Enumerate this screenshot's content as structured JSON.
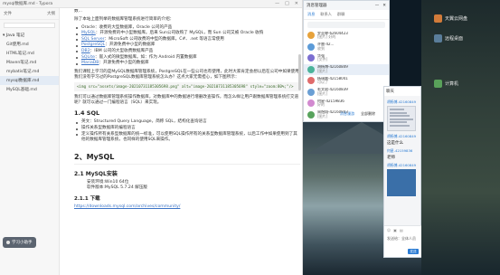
{
  "typora": {
    "title": "mysql数据库.md - Typora",
    "controls": [
      "—",
      "□",
      "✕"
    ]
  },
  "sidebar": {
    "tab_files": "文件",
    "tab_outline": "大纲",
    "folder": "Java 笔记",
    "items": [
      "Git使用.md",
      "HTML笔记.md",
      "Maven笔记.md",
      "mybatis笔记.md",
      "mysql数据库.md",
      "MySQL基础.md"
    ],
    "badge": "学习小助手"
  },
  "editor": {
    "intro_tail": "数...",
    "intro": "除了本站上面列举的数据库管理系统进行简单的介绍：",
    "bullets": [
      [
        "",
        "Oracle：收费的大型数据库，Oracle 公司的产品"
      ],
      [
        "MySQL",
        "：开源免费的中小型数据库。后来 Sun公司收购了 MySQL，而 Sun 公司又被 Oracle 收购"
      ],
      [
        "SQL Server",
        "：MicroSoft 公司收费的中型的数据库。C#、.net 等语言常使用"
      ],
      [
        "PostgreSQL",
        "：开源免费中小型的数据库"
      ],
      [
        "DB2",
        "：IBM 公司的大型收费数据库产品"
      ],
      [
        "SQLite",
        "：嵌入式的微型数据库。如：作为 Android 内置数据库"
      ],
      [
        "MariaDB",
        "：开源免费中小型的数据库"
      ]
    ],
    "para1": "我们课程上学习的是MySQL数据库管理系统，PostgreSQL在一些公司也有使用，此时大家肯定会想以后在公司中如果使用我们没有学习过的PostgreSQL数据库管理系统怎么办？这点大家无需担心，如下图所示：",
    "code": "<img src=\"assets/image-20210731185305698.png\" alt=\"image-20210731185305698\" style=\"zoom:80%;\"/>",
    "para2": "我们可以通过数据库管理系统操作数据库，对数据库中的数据进行增删改查操作，而怎么样让用户跟数据库管理系统打交道呢？就可以通过一门编程语言（SQL）来实现。",
    "h_sql": "1.4 SQL",
    "sql_bullets": [
      "英文：Structured Query Language，简称 SQL，结构化查询语言",
      "操作关系型数据库的编程语言",
      "定义操作所有关系型数据库的统一标准，可以使用SQL操作所有的关系型数据库管理系统，以后工作中如果使用到了其他的数据库管理系统，也同样的使用SQL来操作。"
    ],
    "h2": "2、MySQL",
    "h3": "2.1 MySQL安装",
    "env1": "安装环境:Win10 64位",
    "env2": "软件版本:MySQL 5.7.24 解压版",
    "h4": "2.1.1 下载",
    "download_link": "https://downloads.mysql.com/archives/community/"
  },
  "msgmgr": {
    "title": "消息管理器",
    "tabs": [
      "消息",
      "联系人",
      "群聊"
    ],
    "items": [
      {
        "name": "罗亚婷-62604423",
        "sub": "[图片] 好的",
        "color": "#e7a23b"
      },
      {
        "name": "许雷-42...",
        "sub": "收到",
        "color": "#5c9bd8"
      },
      {
        "name": "华强",
        "sub": "[文件]",
        "color": "#7c6fd1"
      },
      {
        "name": "胡杨博-42160849",
        "sub": "[图片]",
        "color": "#4bb39a"
      },
      {
        "name": "杨瑞晨-42158041",
        "sub": "可以了",
        "color": "#e06b6b"
      },
      {
        "name": "毛文斌-42160839",
        "sub": "[图片]",
        "color": "#6a9fd4"
      },
      {
        "name": "何星-42159836",
        "sub": "好的",
        "color": "#d28ad0"
      },
      {
        "name": "周煜翔-42160843",
        "sub": "[图片]",
        "color": "#58a35d"
      }
    ],
    "foot": [
      "消息漫游",
      "全部删除"
    ]
  },
  "chat": {
    "title": "聊天",
    "messages": [
      {
        "name": "胡杨博-42160849",
        "text": "",
        "type": "img"
      },
      {
        "name": "胡杨博-42160849",
        "text": "这是什么",
        "type": "text"
      },
      {
        "name": "何星-42159836",
        "text": "老师",
        "type": "text"
      },
      {
        "name": "胡杨博-42160849",
        "text": "",
        "type": "img2"
      }
    ],
    "input_hint": "发送给：全体人员",
    "send": "发送"
  },
  "desktop": {
    "icons": [
      "天翼云网盘",
      "远程桌面",
      "计算机"
    ]
  }
}
